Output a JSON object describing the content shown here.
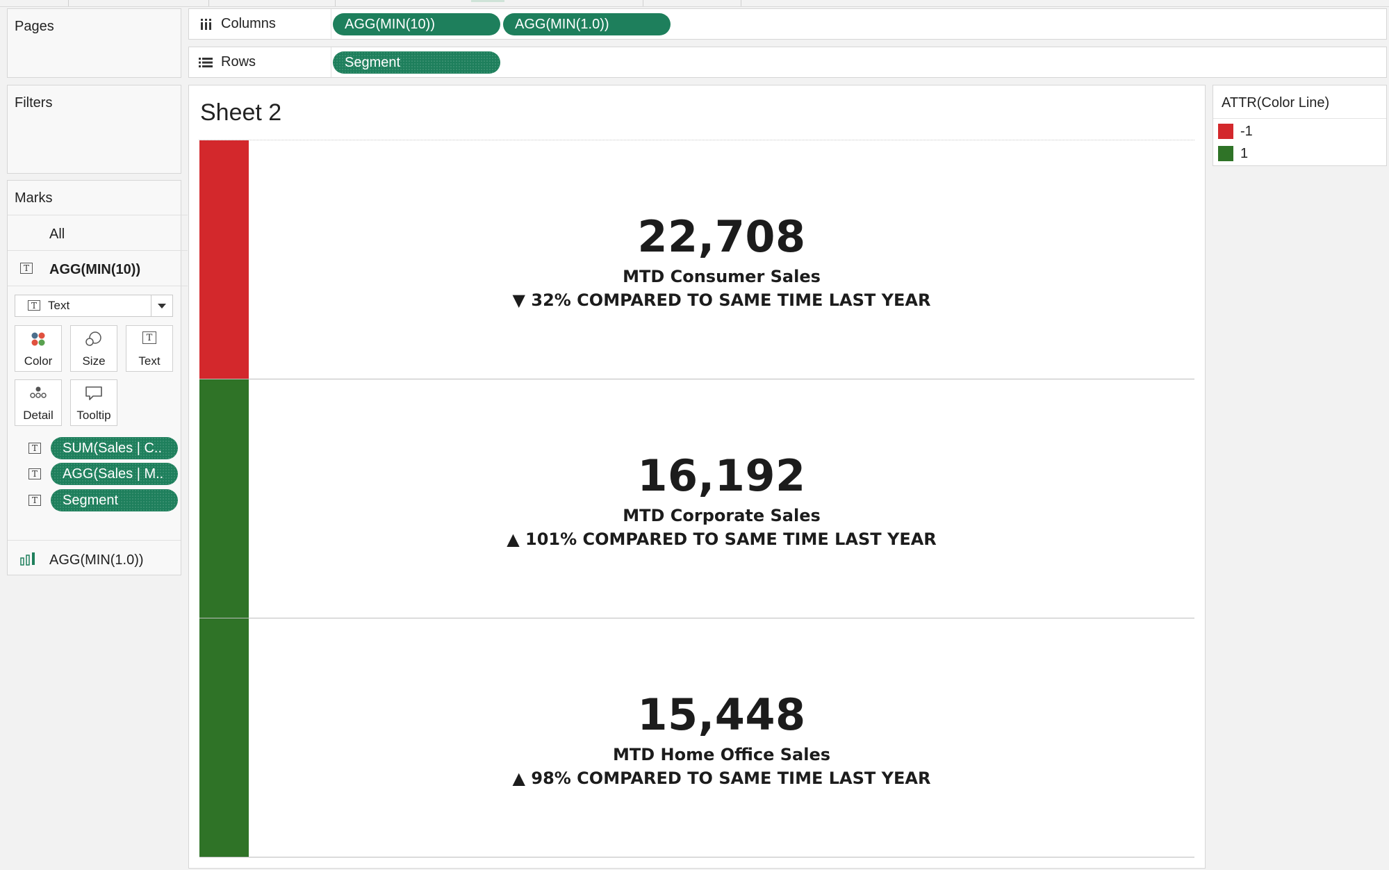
{
  "side": {
    "pages_title": "Pages",
    "filters_title": "Filters",
    "marks": {
      "title": "Marks",
      "all_label": "All",
      "layer1_label": "AGG(MIN(10))",
      "mark_type": "Text",
      "buttons": {
        "color": "Color",
        "size": "Size",
        "text": "Text",
        "detail": "Detail",
        "tooltip": "Tooltip"
      },
      "fields": [
        "SUM(Sales | C..",
        "AGG(Sales | M..",
        "Segment"
      ],
      "layer2_label": "AGG(MIN(1.0))"
    }
  },
  "shelves": {
    "columns_label": "Columns",
    "columns_pills": [
      "AGG(MIN(10))",
      "AGG(MIN(1.0))"
    ],
    "rows_label": "Rows",
    "rows_pills": [
      "Segment"
    ]
  },
  "view": {
    "sheet_title": "Sheet 2",
    "kpis": [
      {
        "value": "22,708",
        "label": "MTD Consumer Sales",
        "arrow": "▼",
        "comparison": "32% COMPARED TO SAME TIME LAST YEAR",
        "color_line": "-1",
        "bar_color": "#d3282c"
      },
      {
        "value": "16,192",
        "label": "MTD Corporate Sales",
        "arrow": "▲",
        "comparison": "101% COMPARED TO SAME TIME LAST YEAR",
        "color_line": "1",
        "bar_color": "#2f7327"
      },
      {
        "value": "15,448",
        "label": "MTD Home Office Sales",
        "arrow": "▲",
        "comparison": "98% COMPARED TO SAME TIME LAST YEAR",
        "color_line": "1",
        "bar_color": "#2f7327"
      }
    ]
  },
  "legend": {
    "title": "ATTR(Color Line)",
    "items": [
      {
        "label": "-1",
        "color": "#d3282c"
      },
      {
        "label": "1",
        "color": "#2f7327"
      }
    ]
  },
  "colors": {
    "pill": "#1e7f5c",
    "negative": "#d3282c",
    "positive": "#2f7327"
  }
}
